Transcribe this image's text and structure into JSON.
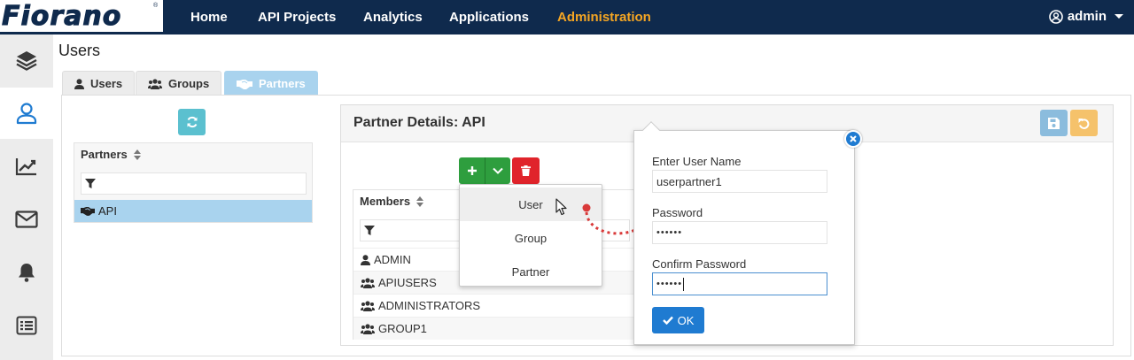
{
  "brand": {
    "logo": "Fiorano",
    "reg_mark": "®"
  },
  "nav": {
    "items": [
      {
        "label": "Home"
      },
      {
        "label": "API Projects"
      },
      {
        "label": "Analytics"
      },
      {
        "label": "Applications"
      },
      {
        "label": "Administration"
      }
    ],
    "active": "Administration",
    "user": "admin"
  },
  "sidebar": {
    "items": [
      {
        "icon": "layers-icon"
      },
      {
        "icon": "user-icon",
        "active": true
      },
      {
        "icon": "chart-line-icon"
      },
      {
        "icon": "envelope-icon"
      },
      {
        "icon": "bell-icon"
      },
      {
        "icon": "list-icon"
      }
    ]
  },
  "page": {
    "title": "Users"
  },
  "tabs": [
    {
      "label": "Users",
      "icon": "user-icon"
    },
    {
      "label": "Groups",
      "icon": "users-icon"
    },
    {
      "label": "Partners",
      "icon": "handshake-icon",
      "active": true
    }
  ],
  "partners": {
    "header": "Partners",
    "selected": "API"
  },
  "details": {
    "title": "Partner Details: API",
    "members_header": "Members",
    "members": [
      {
        "name": "ADMIN",
        "icon": "user-icon"
      },
      {
        "name": "APIUSERS",
        "icon": "users-icon"
      },
      {
        "name": "ADMINISTRATORS",
        "icon": "users-icon"
      },
      {
        "name": "GROUP1",
        "icon": "users-icon"
      }
    ]
  },
  "add_menu": {
    "items": [
      {
        "label": "User"
      },
      {
        "label": "Group"
      },
      {
        "label": "Partner"
      }
    ]
  },
  "popover": {
    "username_label": "Enter User Name",
    "username_value": "userpartner1",
    "password_label": "Password",
    "password_value": "••••••",
    "confirm_label": "Confirm Password",
    "confirm_value": "••••••",
    "ok_label": "OK"
  },
  "colors": {
    "nav_bg": "#0f2a4d",
    "nav_active": "#f5a623",
    "tab_active": "#a9d3ee",
    "refresh_btn": "#5bc0cf",
    "add_btn": "#2e9e3e",
    "delete_btn": "#e0242b",
    "save_btn": "#8bbcdd",
    "undo_btn": "#f5c26b",
    "ok_btn": "#1f7bd1",
    "annotation": "#d93a3a"
  }
}
